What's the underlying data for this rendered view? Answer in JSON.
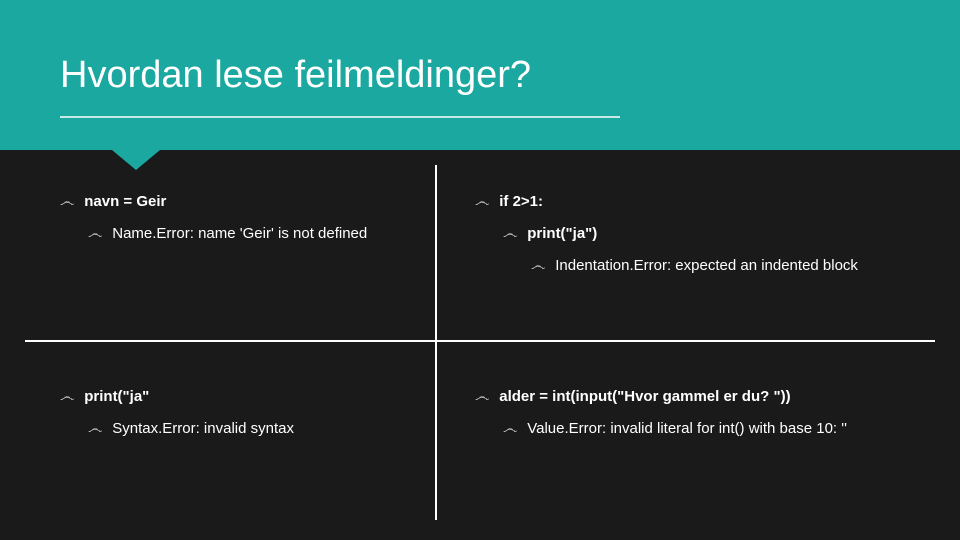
{
  "header": {
    "title": "Hvordan lese feilmeldinger?"
  },
  "bullet_glyph": "෴",
  "cells": {
    "tl": {
      "main": "navn = Geir",
      "sub": "Name.Error: name 'Geir' is not defined"
    },
    "tr": {
      "main": "if 2>1:",
      "sub": "print(\"ja\")",
      "sub_bold": true,
      "sub2": "Indentation.Error: expected an indented block"
    },
    "bl": {
      "main": "print(\"ja\"",
      "sub": "Syntax.Error: invalid syntax"
    },
    "br": {
      "main": "alder = int(input(\"Hvor gammel er du? \"))",
      "sub": "Value.Error: invalid literal for int() with base 10: ''"
    }
  }
}
